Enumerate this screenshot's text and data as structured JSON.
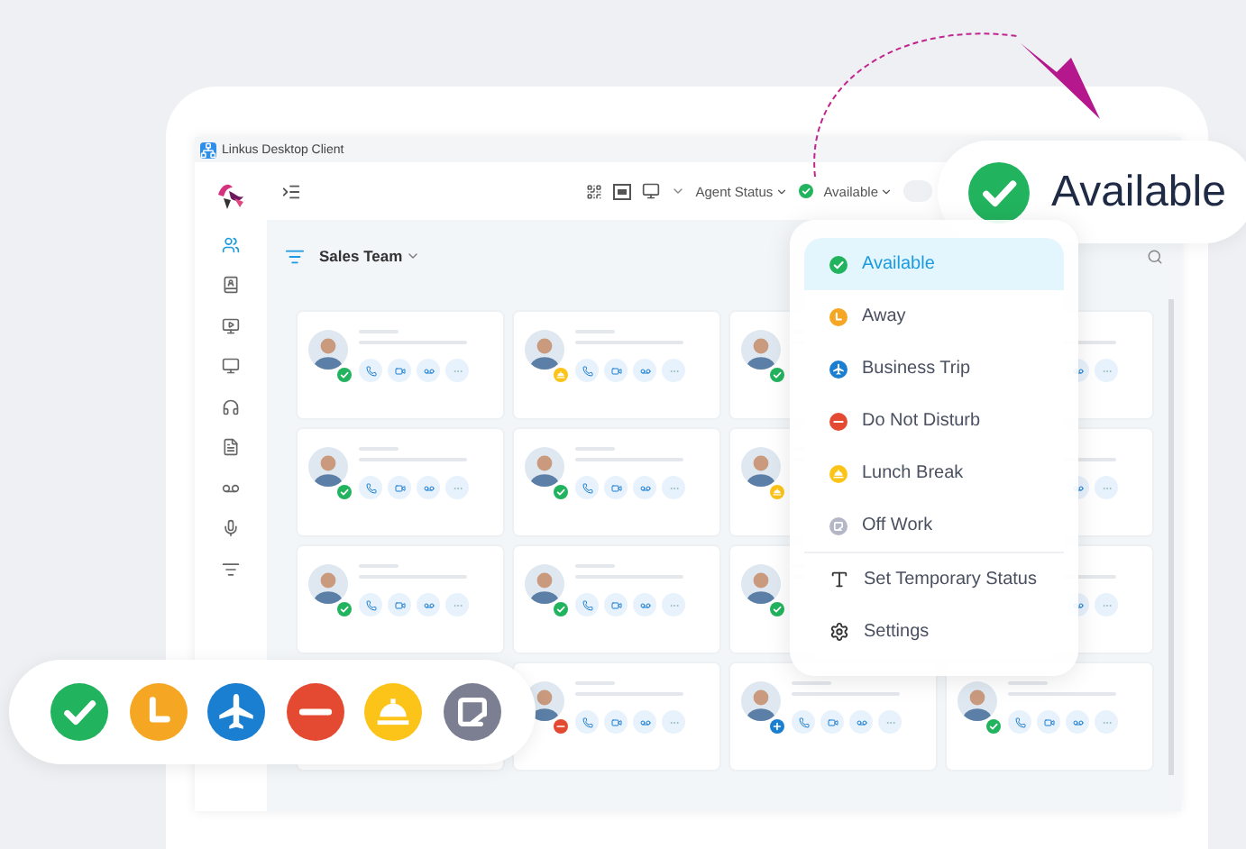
{
  "window": {
    "title": "Linkus Desktop Client"
  },
  "toolbar": {
    "agent_status": "Agent Status",
    "status": {
      "label": "Available",
      "kind": "available",
      "color": "#22b35e"
    }
  },
  "group": {
    "name": "Sales Team"
  },
  "contacts": [
    {
      "kind": "available",
      "color": "#22b35e"
    },
    {
      "kind": "lunch",
      "color": "#fcc419"
    },
    {
      "kind": "available",
      "color": "#22b35e",
      "actions_covered": true
    },
    {
      "kind": "covered"
    },
    {
      "kind": "available",
      "color": "#22b35e"
    },
    {
      "kind": "available",
      "color": "#22b35e"
    },
    {
      "kind": "lunch",
      "color": "#fcc419",
      "actions_covered": true
    },
    {
      "kind": "covered"
    },
    {
      "kind": "available",
      "color": "#22b35e"
    },
    {
      "kind": "available",
      "color": "#22b35e"
    },
    {
      "kind": "available",
      "color": "#22b35e",
      "actions_covered": true
    },
    {
      "kind": "covered"
    },
    {
      "kind": "hidden"
    },
    {
      "kind": "dnd",
      "color": "#e44a32"
    },
    {
      "kind": "added",
      "color": "#1a7fd1"
    },
    {
      "kind": "available",
      "color": "#22b35e"
    }
  ],
  "status_menu": {
    "items": [
      {
        "kind": "available",
        "label": "Available",
        "color": "#22b35e",
        "selected": true
      },
      {
        "kind": "away",
        "label": "Away",
        "color": "#f5a623",
        "selected": false
      },
      {
        "kind": "trip",
        "label": "Business Trip",
        "color": "#1a7fd1",
        "selected": false
      },
      {
        "kind": "dnd",
        "label": "Do Not Disturb",
        "color": "#e44a32",
        "selected": false
      },
      {
        "kind": "lunch",
        "label": "Lunch Break",
        "color": "#fcc419",
        "selected": false
      },
      {
        "kind": "off",
        "label": "Off Work",
        "color": "#b4b7c6",
        "selected": false
      }
    ],
    "actions": [
      {
        "kind": "temporary",
        "label": "Set Temporary Status"
      },
      {
        "kind": "settings",
        "label": "Settings"
      }
    ]
  },
  "callout": {
    "label": "Available",
    "kind": "available",
    "color": "#22b35e"
  },
  "status_strip": [
    {
      "kind": "available",
      "color": "#22b35e"
    },
    {
      "kind": "away",
      "color": "#f5a623"
    },
    {
      "kind": "trip",
      "color": "#1a7fd1"
    },
    {
      "kind": "dnd",
      "color": "#e44a32"
    },
    {
      "kind": "lunch",
      "color": "#fcc419"
    },
    {
      "kind": "off",
      "color": "#7c7f92"
    }
  ]
}
